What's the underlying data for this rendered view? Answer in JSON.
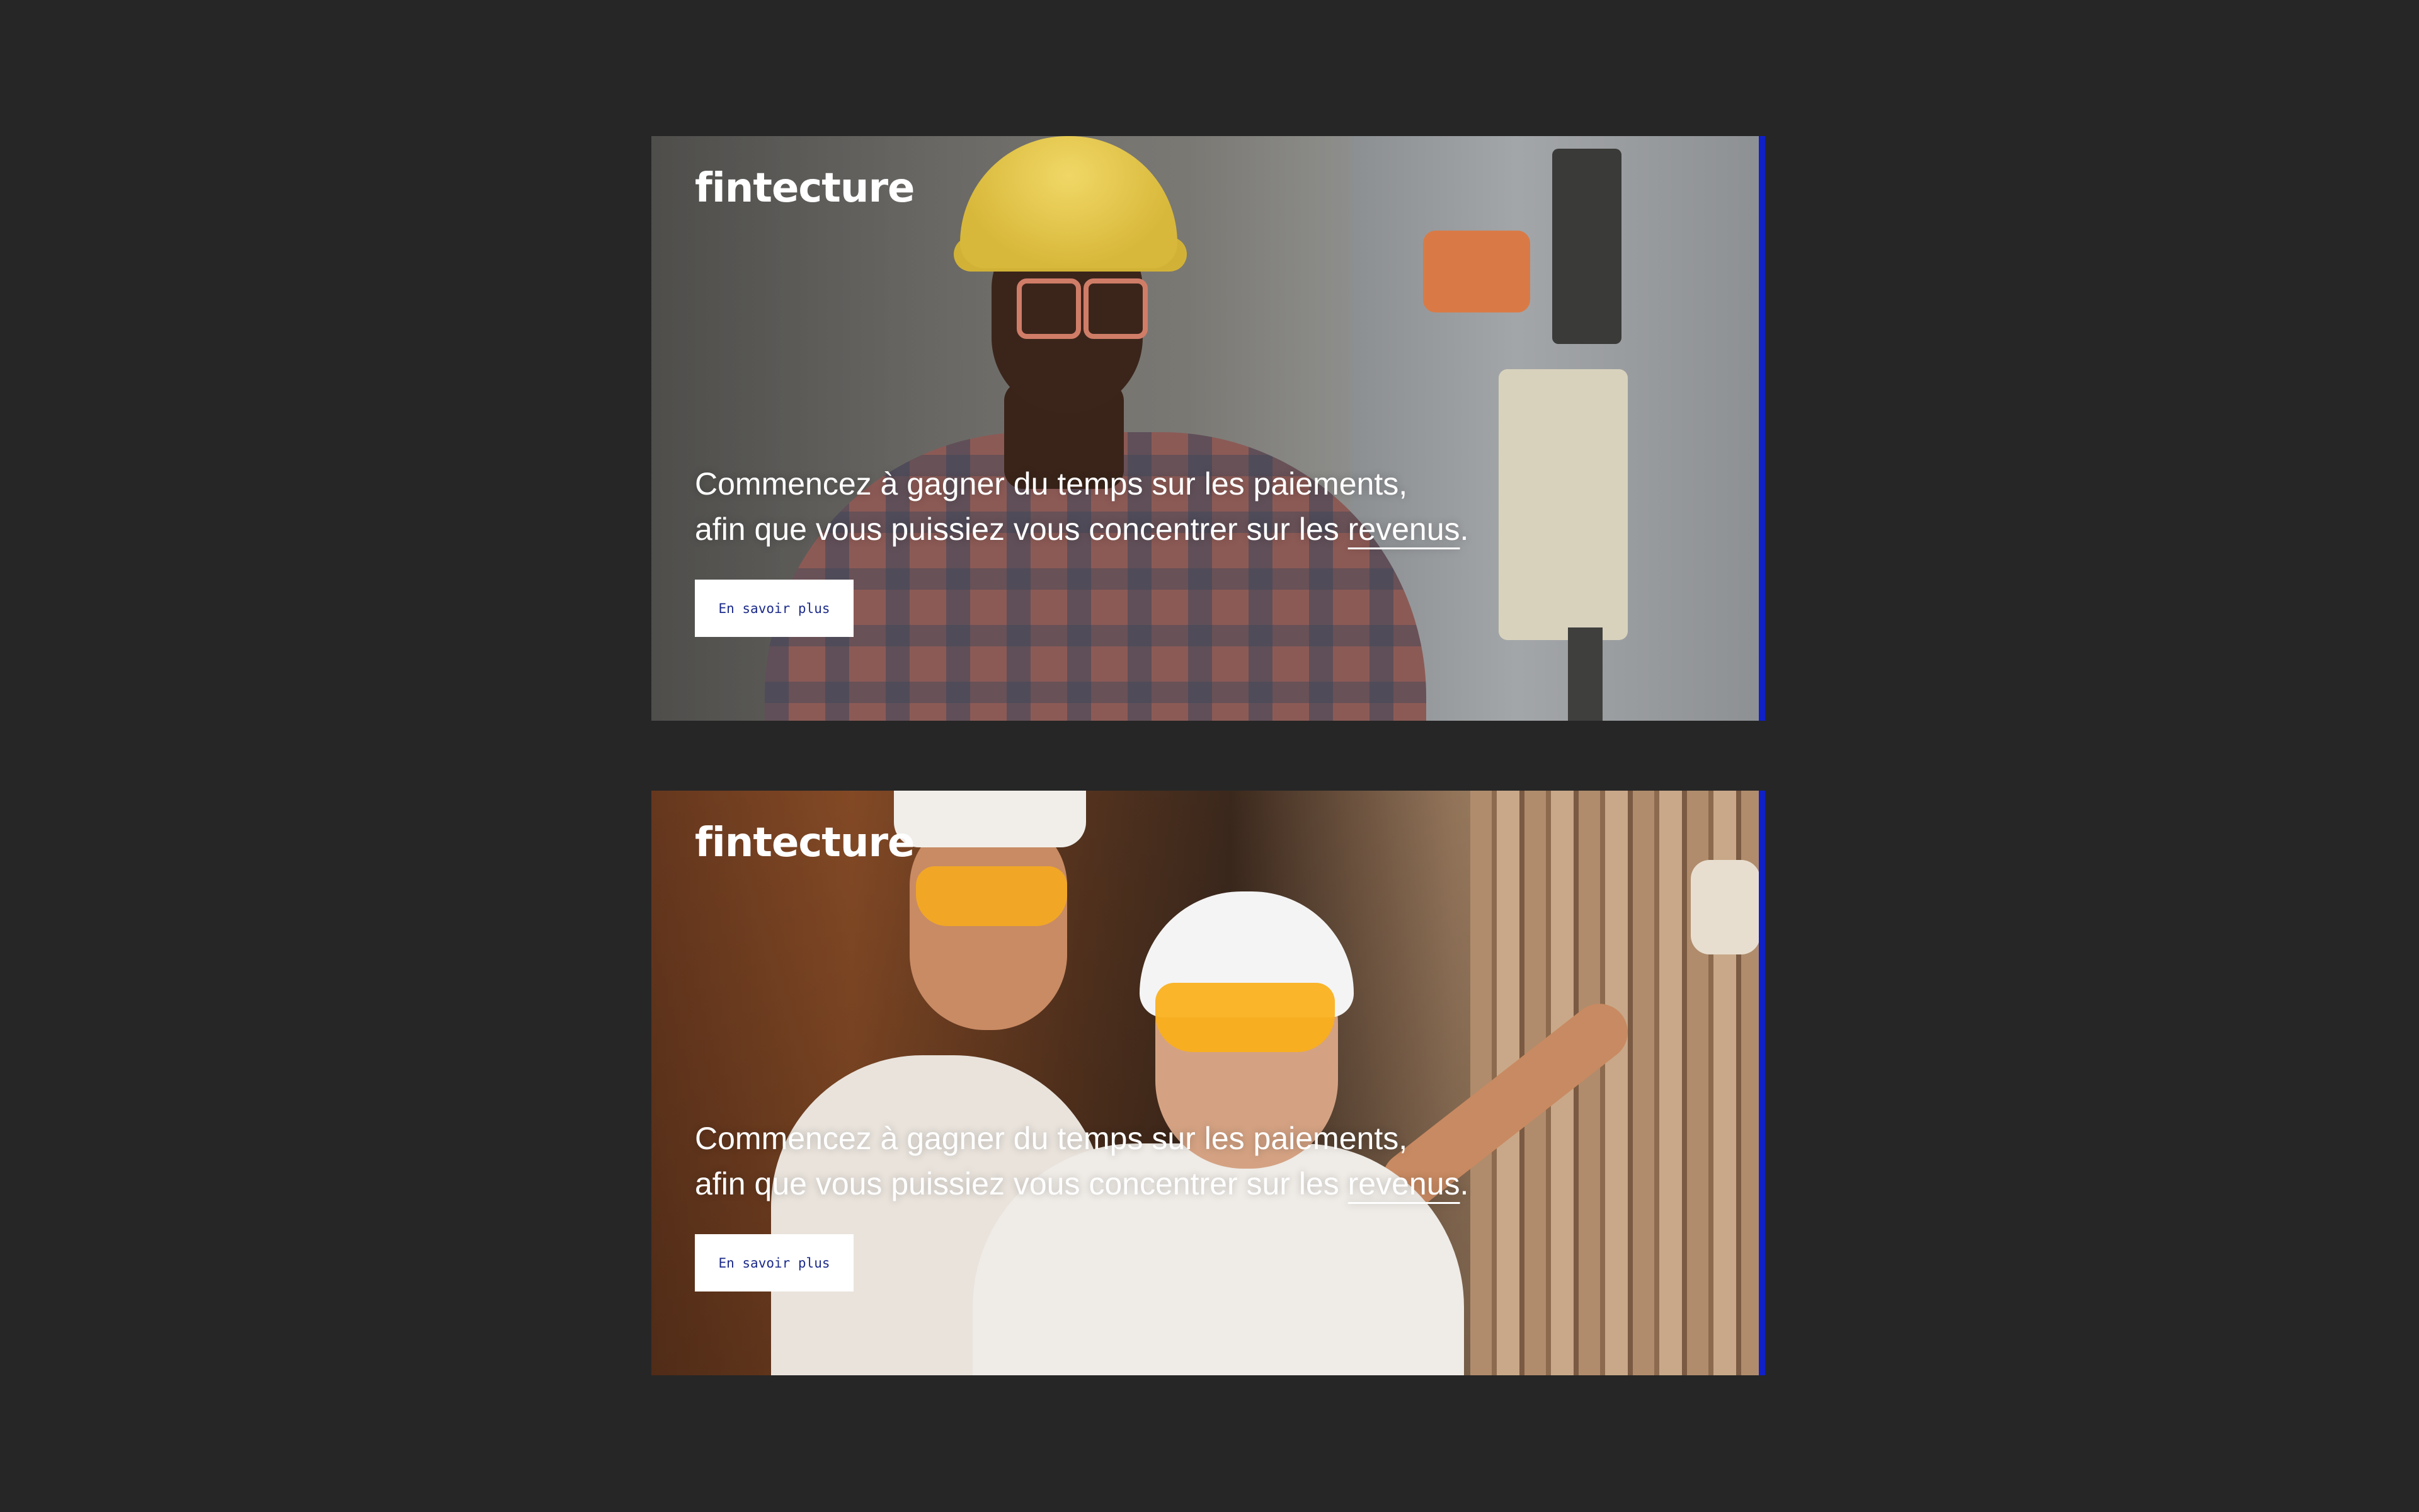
{
  "colors": {
    "page_background": "#262626",
    "accent": "#1020c8",
    "text_on_image": "#ffffff",
    "button_background": "#ffffff",
    "button_text": "#1b2a8a"
  },
  "banners": [
    {
      "logo": "fintecture",
      "headline_line1": "Commencez à gagner du temps sur les paiements,",
      "headline_line2_prefix": "afin que vous puissiez vous concentrer sur les ",
      "headline_highlight": "revenus",
      "headline_suffix": ".",
      "cta_label": "En savoir plus"
    },
    {
      "logo": "fintecture",
      "headline_line1": "Commencez à gagner du temps sur les paiements,",
      "headline_line2_prefix": "afin que vous puissiez vous concentrer sur les ",
      "headline_highlight": "revenus",
      "headline_suffix": ".",
      "cta_label": "En savoir plus"
    }
  ]
}
